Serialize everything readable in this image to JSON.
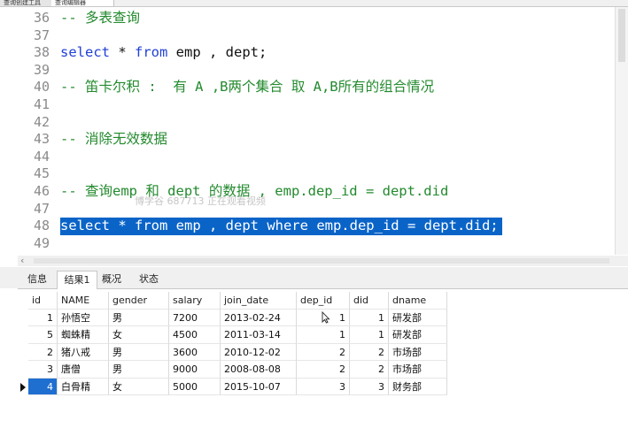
{
  "top_tabs": [
    "查询创建工具",
    "查询编辑器"
  ],
  "editor": {
    "lines": [
      {
        "num": "36",
        "parts": [
          {
            "t": "-- 多表查询",
            "c": "cmt"
          }
        ]
      },
      {
        "num": "37",
        "parts": []
      },
      {
        "num": "38",
        "parts": [
          {
            "t": "select",
            "c": "kw"
          },
          {
            "t": " * ",
            "c": ""
          },
          {
            "t": "from",
            "c": "kw"
          },
          {
            "t": " emp , dept;",
            "c": ""
          }
        ]
      },
      {
        "num": "39",
        "parts": []
      },
      {
        "num": "40",
        "parts": [
          {
            "t": "-- 笛卡尔积 :  有 A ,B两个集合 取 A,B所有的组合情况",
            "c": "cmt"
          }
        ]
      },
      {
        "num": "41",
        "parts": []
      },
      {
        "num": "42",
        "parts": []
      },
      {
        "num": "43",
        "parts": [
          {
            "t": "-- 消除无效数据",
            "c": "cmt"
          }
        ]
      },
      {
        "num": "44",
        "parts": []
      },
      {
        "num": "45",
        "parts": []
      },
      {
        "num": "46",
        "parts": [
          {
            "t": "-- 查询emp 和 dept 的数据 , emp.dep_id = dept.did",
            "c": "cmt"
          }
        ]
      },
      {
        "num": "47",
        "parts": []
      },
      {
        "num": "48",
        "parts": [
          {
            "t": "select",
            "c": "kw"
          },
          {
            "t": " * ",
            "c": ""
          },
          {
            "t": "from",
            "c": "kw"
          },
          {
            "t": " emp , dept ",
            "c": ""
          },
          {
            "t": "where",
            "c": "kw"
          },
          {
            "t": " emp.dep_id = dept.did;",
            "c": ""
          }
        ],
        "selected": true
      },
      {
        "num": "49",
        "parts": []
      }
    ],
    "watermark": "博学谷 687713 正在观看视频"
  },
  "result_tabs": [
    "信息",
    "结果1",
    "概况",
    "状态"
  ],
  "table": {
    "columns": [
      "id",
      "NAME",
      "gender",
      "salary",
      "join_date",
      "dep_id",
      "did",
      "dname"
    ],
    "rows": [
      [
        "1",
        "孙悟空",
        "男",
        "7200",
        "2013-02-24",
        "1",
        "1",
        "研发部"
      ],
      [
        "5",
        "蜘蛛精",
        "女",
        "4500",
        "2011-03-14",
        "1",
        "1",
        "研发部"
      ],
      [
        "2",
        "猪八戒",
        "男",
        "3600",
        "2010-12-02",
        "2",
        "2",
        "市场部"
      ],
      [
        "3",
        "唐僧",
        "男",
        "9000",
        "2008-08-08",
        "2",
        "2",
        "市场部"
      ],
      [
        "4",
        "白骨精",
        "女",
        "5000",
        "2015-10-07",
        "3",
        "3",
        "财务部"
      ]
    ],
    "selected_row": 4
  }
}
